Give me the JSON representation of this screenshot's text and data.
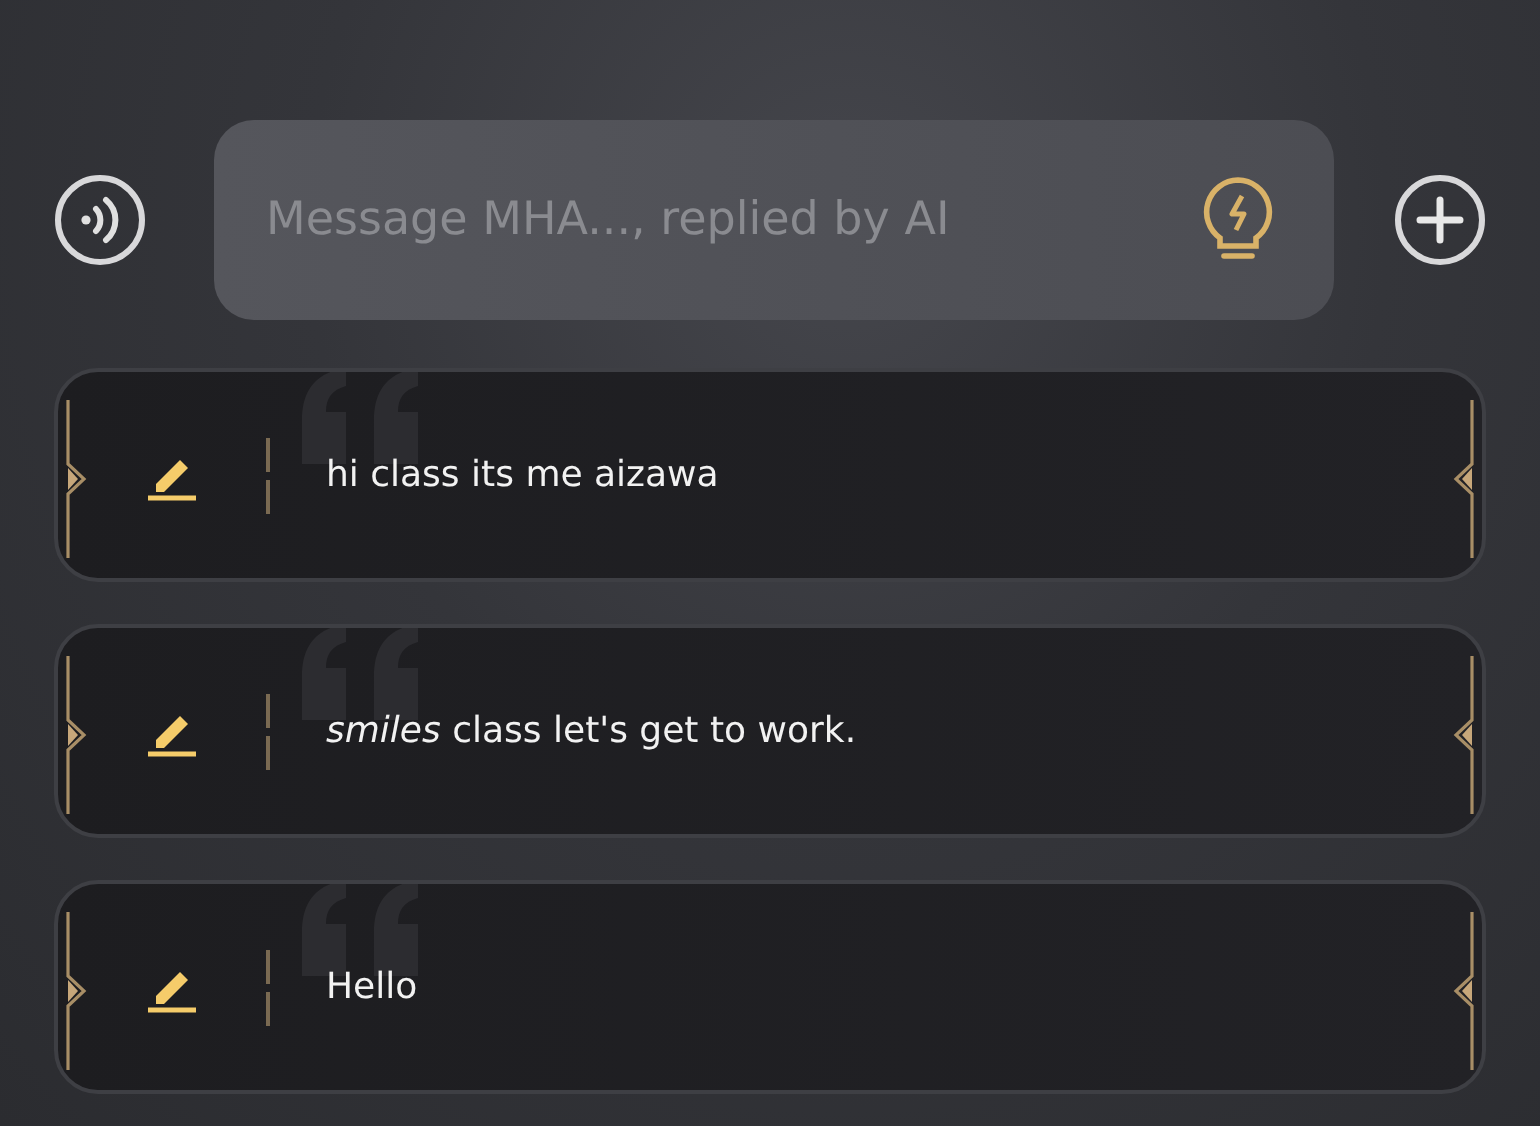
{
  "composer": {
    "placeholder": "Message MHA..., replied by AI"
  },
  "messages": [
    {
      "text": "hi class its me aizawa"
    },
    {
      "text": "*smiles* class let's get to work."
    },
    {
      "text": "Hello"
    }
  ]
}
